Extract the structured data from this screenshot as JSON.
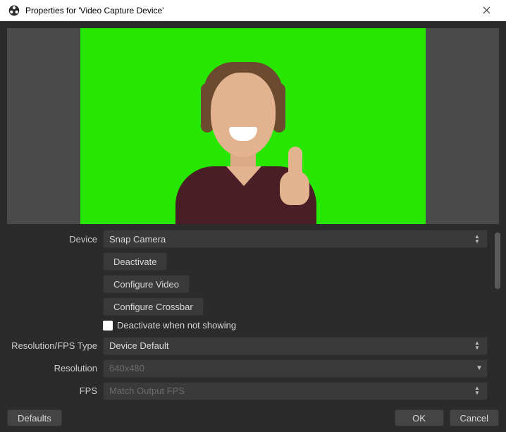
{
  "window": {
    "title": "Properties for 'Video Capture Device'"
  },
  "form": {
    "device_label": "Device",
    "device_value": "Snap Camera",
    "deactivate_label": "Deactivate",
    "configure_video_label": "Configure Video",
    "configure_crossbar_label": "Configure Crossbar",
    "deactivate_when_not_showing_label": "Deactivate when not showing",
    "resolution_fps_type_label": "Resolution/FPS Type",
    "resolution_fps_type_value": "Device Default",
    "resolution_label": "Resolution",
    "resolution_value": "640x480",
    "fps_label": "FPS",
    "fps_value": "Match Output FPS"
  },
  "footer": {
    "defaults_label": "Defaults",
    "ok_label": "OK",
    "cancel_label": "Cancel"
  },
  "colors": {
    "greenscreen": "#27e600"
  }
}
